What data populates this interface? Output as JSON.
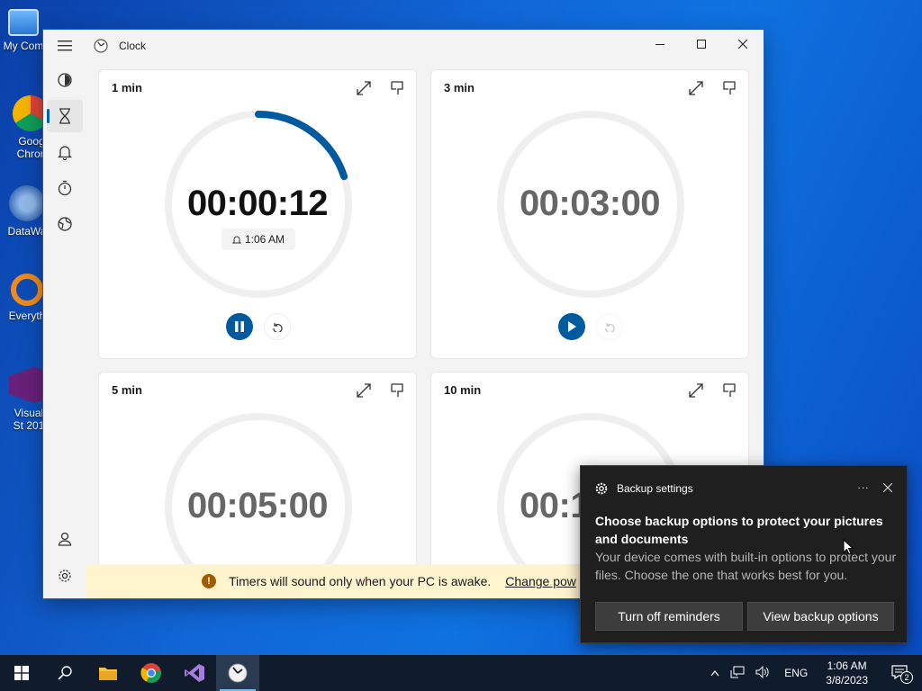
{
  "desktop": {
    "icons": [
      {
        "label": "My Com"
      },
      {
        "label": "Goog Chron"
      },
      {
        "label": "DataWa"
      },
      {
        "label": "Everyth"
      },
      {
        "label": "Visual St 201"
      }
    ]
  },
  "window": {
    "title": "Clock",
    "nav_items": [
      "focus-sessions",
      "timer",
      "alarm",
      "stopwatch",
      "world-clock"
    ],
    "timers": [
      {
        "name": "1 min",
        "time": "00:00:12",
        "alarm": "1:06 AM",
        "running": true,
        "progress": 0.2
      },
      {
        "name": "3 min",
        "time": "00:03:00",
        "running": false,
        "progress": 0
      },
      {
        "name": "5 min",
        "time": "00:05:00",
        "running": false,
        "progress": 0
      },
      {
        "name": "10 min",
        "time": "00:1",
        "running": false,
        "progress": 0
      }
    ],
    "banner": {
      "text": "Timers will sound only when your PC is awake.",
      "link": "Change pow"
    }
  },
  "toast": {
    "app": "Backup settings",
    "more": "···",
    "title": "Choose backup options to protect your pictures and documents",
    "body": "Your device comes with built-in options to protect your files. Choose the one that works best for you.",
    "button_1": "Turn off reminders",
    "button_2": "View backup options"
  },
  "taskbar": {
    "language": "ENG",
    "time": "1:06 AM",
    "date": "3/8/2023",
    "notification_count": "2"
  },
  "colors": {
    "accent": "#005a9e",
    "ring_track": "#efefef",
    "banner_bg": "#fff4ce"
  }
}
